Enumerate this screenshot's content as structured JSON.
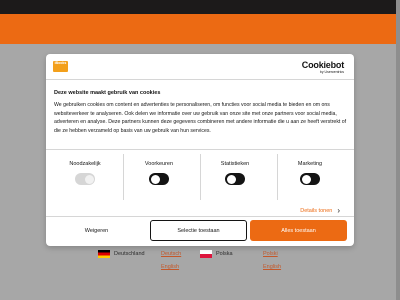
{
  "background": {
    "languages": [
      {
        "country": "Deutschland",
        "flag": "flag-de",
        "link1": "Deutsch",
        "link2": "English"
      },
      {
        "country": "Polska",
        "flag": "flag-pl",
        "link1": "Polski",
        "link2": "English"
      }
    ]
  },
  "modal": {
    "brand_logo": "iBooks",
    "cookiebot_name": "Cookiebot",
    "cookiebot_sub": "by Usercentrics",
    "title": "Deze website maakt gebruik van cookies",
    "description": "We gebruiken cookies om content en advertenties te personaliseren, om functies voor social media te bieden en om ons websiteverkeer te analyseren. Ook delen we informatie over uw gebruik van onze site met onze partners voor social media, adverteren en analyse. Deze partners kunnen deze gegevens combineren met andere informatie die u aan ze heeft verstrekt of die ze hebben verzameld op basis van uw gebruik van hun services.",
    "categories": [
      {
        "label": "Noodzakelijk",
        "state": "disabled"
      },
      {
        "label": "Voorkeuren",
        "state": "off"
      },
      {
        "label": "Statistieken",
        "state": "off"
      },
      {
        "label": "Marketing",
        "state": "off"
      }
    ],
    "details_label": "Details tonen",
    "buttons": {
      "deny": "Weigeren",
      "selection": "Selectie toestaan",
      "allow_all": "Alles toestaan"
    }
  },
  "colors": {
    "accent": "#ec6a13",
    "dark": "#141414"
  }
}
